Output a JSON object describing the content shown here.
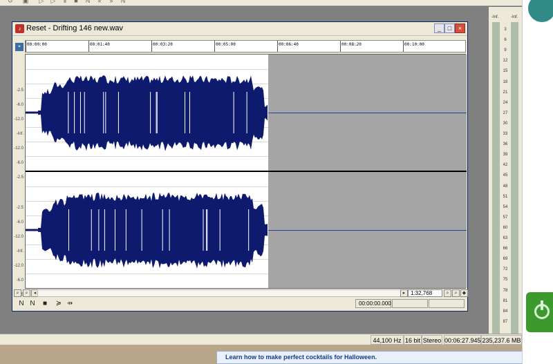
{
  "window": {
    "title": "Reset - Drifting 146 new.wav",
    "minimize": "_",
    "maximize": "□",
    "close": "×"
  },
  "ruler": {
    "ticks": [
      "00:00:00",
      "00:01:40",
      "00:03:20",
      "00:05:00",
      "00:06:40",
      "00:08:20",
      "00:10:00"
    ]
  },
  "db_labels_channel": [
    "-2.5",
    "-6.0",
    "-12.0",
    "-Inf.",
    "-12.0",
    "-6.0",
    "-2.5"
  ],
  "transport": {
    "scroll_time": "1:32,768",
    "cursor_time": "00:00:00.000"
  },
  "status": {
    "sample_rate": "44,100 Hz",
    "bit_depth": "16 bit",
    "channels": "Stereo",
    "duration": "00:06:27.945",
    "disk_space": "235,237.6 MB"
  },
  "tooltip": "Learn how to make perfect cocktails for Halloween.",
  "meter": {
    "top_left": "-Inf.",
    "top_right": "-Inf.",
    "labels": [
      "3",
      "6",
      "9",
      "12",
      "15",
      "18",
      "21",
      "24",
      "27",
      "30",
      "33",
      "36",
      "39",
      "42",
      "45",
      "48",
      "51",
      "54",
      "57",
      "60",
      "63",
      "66",
      "69",
      "72",
      "75",
      "78",
      "81",
      "84",
      "87"
    ]
  },
  "colors": {
    "waveform": "#0d1a6e",
    "unused_region": "#a5a5a5",
    "baseline": "#2a3aa8"
  },
  "waveform": {
    "audio_end_fraction": 0.55
  }
}
